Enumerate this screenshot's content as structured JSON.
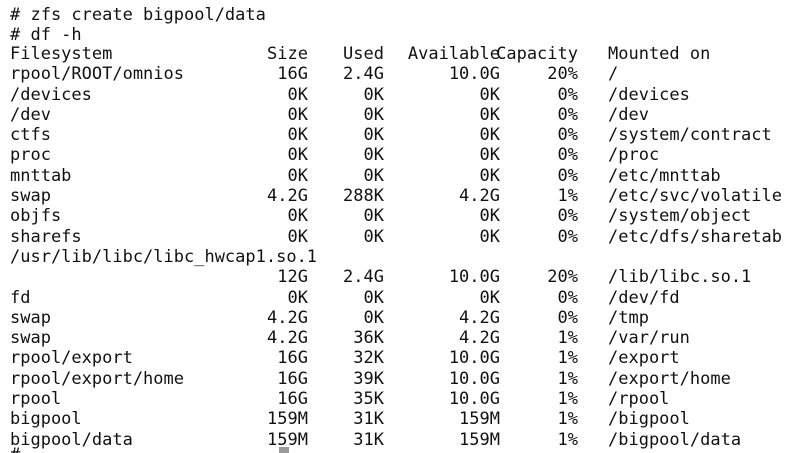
{
  "terminal": {
    "cut_top_line": "                                                                ",
    "commands": [
      "# zfs create bigpool/data",
      "# df -h"
    ],
    "headers": {
      "fs": "Filesystem",
      "size": "Size",
      "used": "Used",
      "avail": "Available",
      "cap": "Capacity",
      "mnt": "Mounted on"
    },
    "rows": [
      {
        "fs": "rpool/ROOT/omnios",
        "size": "16G",
        "used": "2.4G",
        "avail": "10.0G",
        "cap": "20%",
        "mnt": "/"
      },
      {
        "fs": "/devices",
        "size": "0K",
        "used": "0K",
        "avail": "0K",
        "cap": "0%",
        "mnt": "/devices"
      },
      {
        "fs": "/dev",
        "size": "0K",
        "used": "0K",
        "avail": "0K",
        "cap": "0%",
        "mnt": "/dev"
      },
      {
        "fs": "ctfs",
        "size": "0K",
        "used": "0K",
        "avail": "0K",
        "cap": "0%",
        "mnt": "/system/contract"
      },
      {
        "fs": "proc",
        "size": "0K",
        "used": "0K",
        "avail": "0K",
        "cap": "0%",
        "mnt": "/proc"
      },
      {
        "fs": "mnttab",
        "size": "0K",
        "used": "0K",
        "avail": "0K",
        "cap": "0%",
        "mnt": "/etc/mnttab"
      },
      {
        "fs": "swap",
        "size": "4.2G",
        "used": "288K",
        "avail": "4.2G",
        "cap": "1%",
        "mnt": "/etc/svc/volatile"
      },
      {
        "fs": "objfs",
        "size": "0K",
        "used": "0K",
        "avail": "0K",
        "cap": "0%",
        "mnt": "/system/object"
      },
      {
        "fs": "sharefs",
        "size": "0K",
        "used": "0K",
        "avail": "0K",
        "cap": "0%",
        "mnt": "/etc/dfs/sharetab"
      },
      {
        "fs": "/usr/lib/libc/libc_hwcap1.so.1",
        "size": "",
        "used": "",
        "avail": "",
        "cap": "",
        "mnt": ""
      },
      {
        "fs": "",
        "size": "12G",
        "used": "2.4G",
        "avail": "10.0G",
        "cap": "20%",
        "mnt": "/lib/libc.so.1"
      },
      {
        "fs": "fd",
        "size": "0K",
        "used": "0K",
        "avail": "0K",
        "cap": "0%",
        "mnt": "/dev/fd"
      },
      {
        "fs": "swap",
        "size": "4.2G",
        "used": "0K",
        "avail": "4.2G",
        "cap": "0%",
        "mnt": "/tmp"
      },
      {
        "fs": "swap",
        "size": "4.2G",
        "used": "36K",
        "avail": "4.2G",
        "cap": "1%",
        "mnt": "/var/run"
      },
      {
        "fs": "rpool/export",
        "size": "16G",
        "used": "32K",
        "avail": "10.0G",
        "cap": "1%",
        "mnt": "/export"
      },
      {
        "fs": "rpool/export/home",
        "size": "16G",
        "used": "39K",
        "avail": "10.0G",
        "cap": "1%",
        "mnt": "/export/home"
      },
      {
        "fs": "rpool",
        "size": "16G",
        "used": "35K",
        "avail": "10.0G",
        "cap": "1%",
        "mnt": "/rpool"
      },
      {
        "fs": "bigpool",
        "size": "159M",
        "used": "31K",
        "avail": "159M",
        "cap": "1%",
        "mnt": "/bigpool"
      },
      {
        "fs": "bigpool/data",
        "size": "159M",
        "used": "31K",
        "avail": "159M",
        "cap": "1%",
        "mnt": "/bigpool/data"
      }
    ],
    "cut_bottom_line": "#                         "
  }
}
